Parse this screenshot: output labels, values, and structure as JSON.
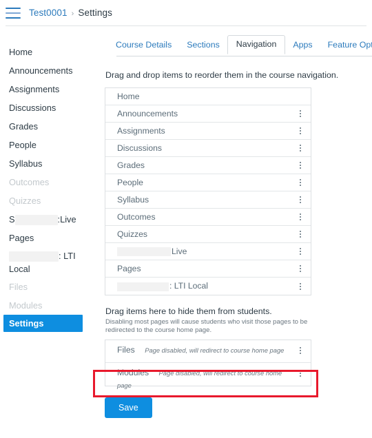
{
  "topbar": {
    "menu_icon": "hamburger-icon",
    "breadcrumb": {
      "course": "Test0001",
      "separator": "›",
      "current": "Settings"
    }
  },
  "course_nav": {
    "items": [
      {
        "label": "Home",
        "state": "enabled"
      },
      {
        "label": "Announcements",
        "state": "enabled"
      },
      {
        "label": "Assignments",
        "state": "enabled"
      },
      {
        "label": "Discussions",
        "state": "enabled"
      },
      {
        "label": "Grades",
        "state": "enabled"
      },
      {
        "label": "People",
        "state": "enabled"
      },
      {
        "label": "Syllabus",
        "state": "enabled"
      },
      {
        "label": "Outcomes",
        "state": "disabled"
      },
      {
        "label": "Quizzes",
        "state": "disabled"
      },
      {
        "label": "S",
        "suffix": ":Live",
        "state": "redacted"
      },
      {
        "label": "Pages",
        "state": "enabled"
      },
      {
        "label": "",
        "suffix": ": LTI Local",
        "state": "redacted"
      },
      {
        "label": "Files",
        "state": "disabled"
      },
      {
        "label": "Modules",
        "state": "disabled"
      },
      {
        "label": "Settings",
        "state": "active"
      }
    ]
  },
  "tabs": [
    {
      "label": "Course Details",
      "active": false
    },
    {
      "label": "Sections",
      "active": false
    },
    {
      "label": "Navigation",
      "active": true
    },
    {
      "label": "Apps",
      "active": false
    },
    {
      "label": "Feature Options",
      "active": false
    }
  ],
  "main": {
    "intro": "Drag and drop items to reorder them in the course navigation.",
    "visible_items": [
      {
        "label": "Home",
        "has_menu": false
      },
      {
        "label": "Announcements",
        "has_menu": true
      },
      {
        "label": "Assignments",
        "has_menu": true
      },
      {
        "label": "Discussions",
        "has_menu": true
      },
      {
        "label": "Grades",
        "has_menu": true
      },
      {
        "label": "People",
        "has_menu": true
      },
      {
        "label": "Syllabus",
        "has_menu": true
      },
      {
        "label": "Outcomes",
        "has_menu": true
      },
      {
        "label": "Quizzes",
        "has_menu": true
      },
      {
        "label": "Live",
        "has_menu": true,
        "redacted": true
      },
      {
        "label": "Pages",
        "has_menu": true
      },
      {
        "label": ": LTI Local",
        "has_menu": true,
        "redacted": true
      }
    ],
    "hidden_section": {
      "heading": "Drag items here to hide them from students.",
      "description": "Disabling most pages will cause students who visit those pages to be redirected to the course home page.",
      "items": [
        {
          "label": "Files",
          "description": "Page disabled, will redirect to course home page",
          "highlighted": false
        },
        {
          "label": "Modules",
          "description": "Page disabled, will redirect to course home page",
          "highlighted": true
        }
      ]
    },
    "save_label": "Save"
  },
  "colors": {
    "link": "#2b7abc",
    "accent": "#0e8ee0",
    "highlight_box": "#e8192c",
    "disabled_text": "#c3c9cd"
  }
}
